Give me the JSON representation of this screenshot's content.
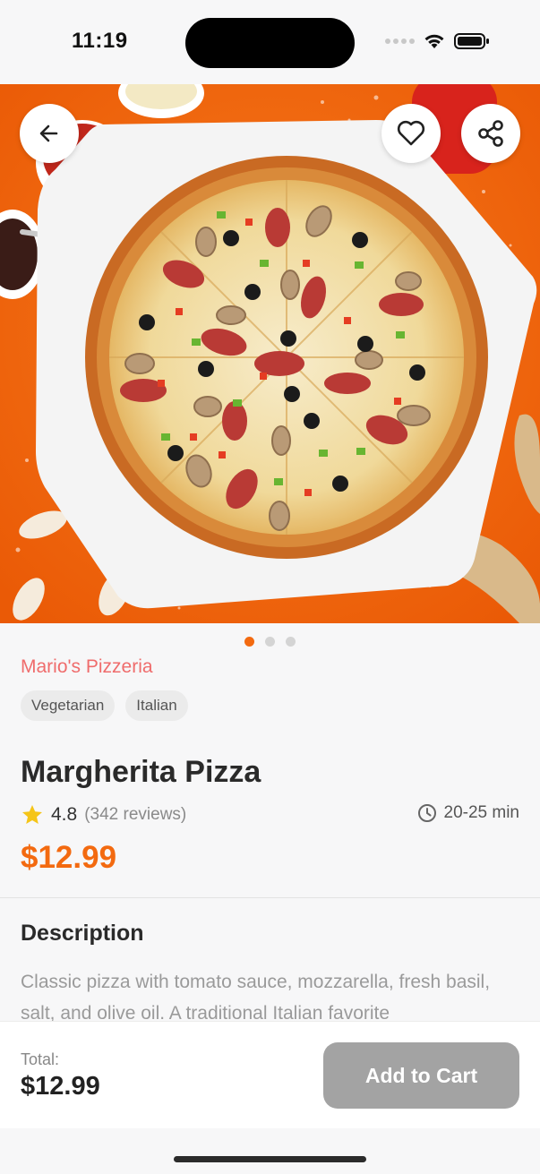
{
  "status_bar": {
    "time": "11:19"
  },
  "hero": {
    "background_color": "#f36a10",
    "slide_count": 3,
    "active_slide": 1,
    "back_icon": "arrow-left-icon",
    "favorite_icon": "heart-icon",
    "share_icon": "share-icon"
  },
  "restaurant": "Mario's Pizzeria",
  "tags": [
    "Vegetarian",
    "Italian"
  ],
  "item": {
    "name": "Margherita Pizza",
    "rating": "4.8",
    "reviews": "(342 reviews)",
    "delivery_time": "20-25 min",
    "price": "$12.99"
  },
  "description": {
    "title": "Description",
    "text": "Classic pizza with tomato sauce, mozzarella, fresh basil, salt, and olive oil. A traditional Italian favorite"
  },
  "bottom_bar": {
    "total_label": "Total:",
    "total_value": "$12.99",
    "add_button": "Add to Cart"
  },
  "colors": {
    "accent": "#f36a10",
    "restaurant_text": "#ef6c6c",
    "button_disabled": "#a3a3a3",
    "star": "#f5c518"
  }
}
